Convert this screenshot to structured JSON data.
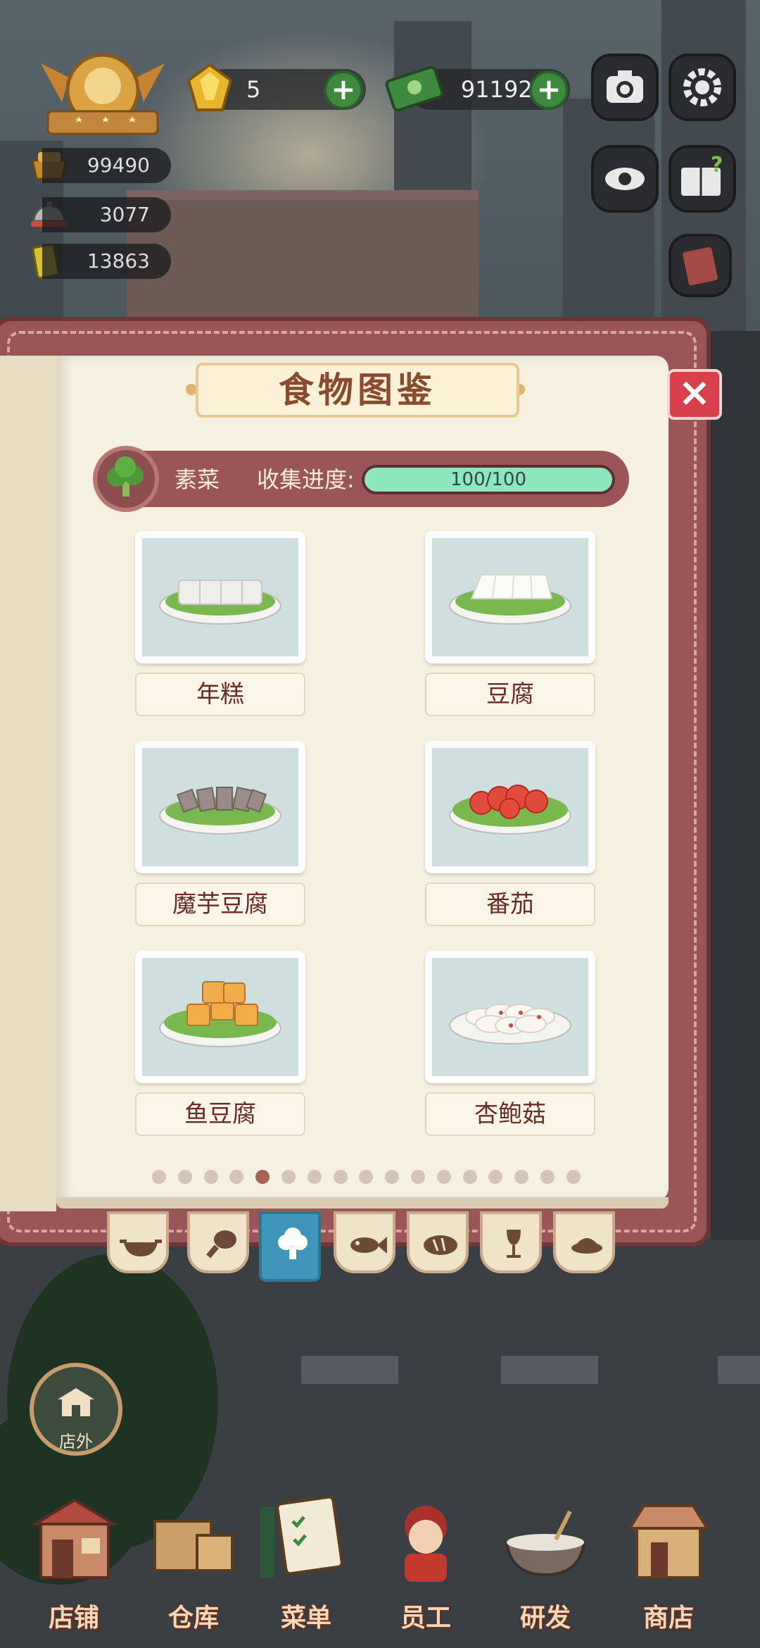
{
  "hud": {
    "gems": "5",
    "cash": "911927",
    "stat1": "99490",
    "stat2": "3077",
    "stat3": "13863"
  },
  "dialog": {
    "title": "食物图鉴",
    "close": "×",
    "category": "素菜",
    "progress_label": "收集进度:",
    "progress_current": "100",
    "progress_total": "/100",
    "progress_fraction": 1.0
  },
  "foods": [
    {
      "name": "年糕",
      "icon": "rice-cake-icon"
    },
    {
      "name": "豆腐",
      "icon": "tofu-icon"
    },
    {
      "name": "魔芋豆腐",
      "icon": "konjac-tofu-icon"
    },
    {
      "name": "番茄",
      "icon": "tomato-icon"
    },
    {
      "name": "鱼豆腐",
      "icon": "fish-tofu-icon"
    },
    {
      "name": "杏鲍菇",
      "icon": "king-oyster-mushroom-icon"
    }
  ],
  "pagination": {
    "count": 17,
    "active": 4
  },
  "tabs": [
    "wok-icon",
    "drumstick-icon",
    "broccoli-icon",
    "fish-icon",
    "bread-icon",
    "wine-glass-icon",
    "dessert-icon"
  ],
  "outside_button": "店外",
  "bottom_nav": [
    "店铺",
    "仓库",
    "菜单",
    "员工",
    "研发",
    "商店"
  ]
}
